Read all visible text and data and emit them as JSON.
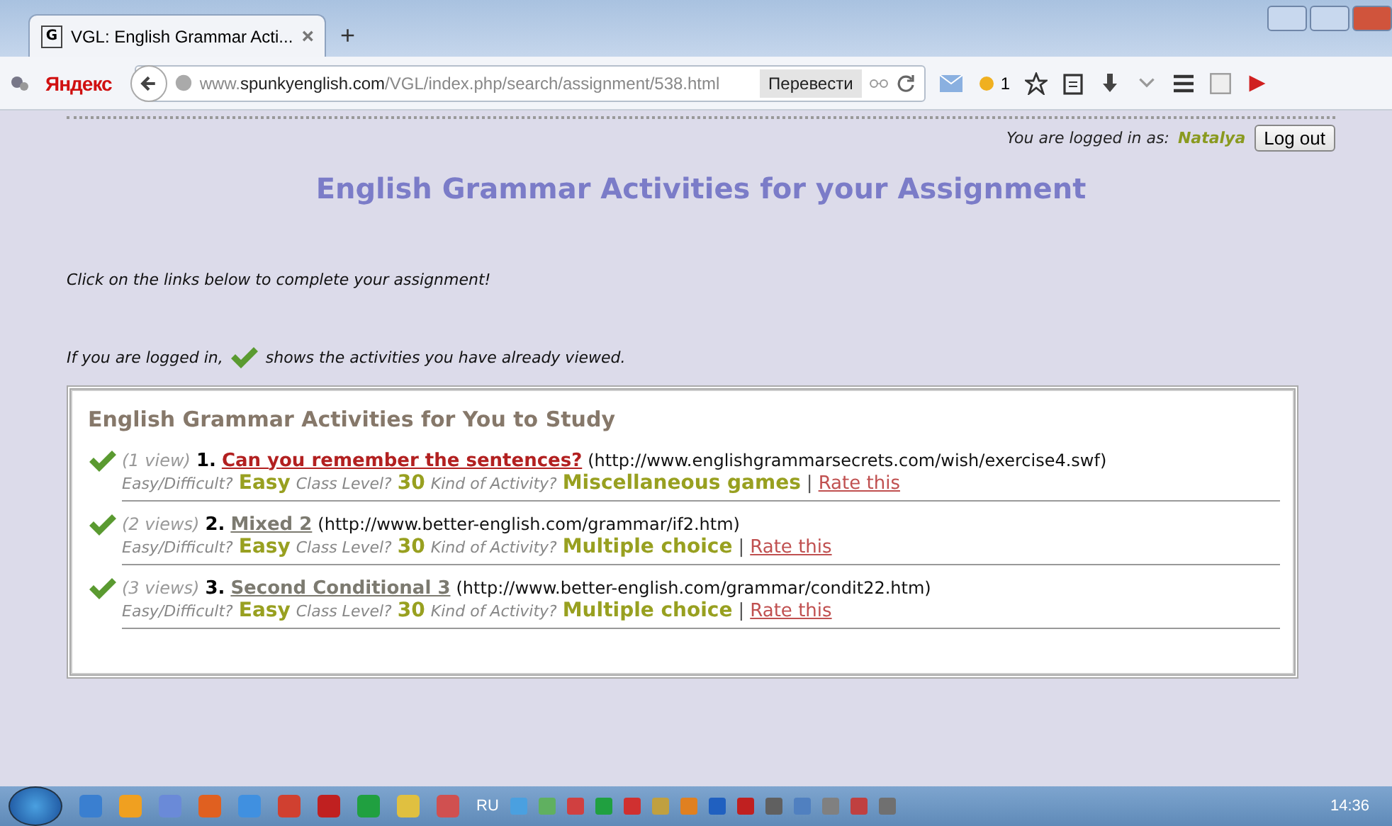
{
  "browser": {
    "favicon": "G",
    "tab_title": "VGL: English Grammar Acti...",
    "new_tab": "+",
    "brand": "Яндекс",
    "url": "www.**spunkyenglish.com**/VGL/index.php/search/assignment/538.html",
    "translate_button": "Перевести",
    "weather_count": "1"
  },
  "login": {
    "label": "You are logged in as:",
    "user": "Natalya",
    "logout_button": "Log out"
  },
  "page_title": "English Grammar Activities for your Assignment",
  "intro": "Click on the links below to complete your assignment!",
  "legend": {
    "before": "If you are logged in,",
    "after": "shows the activities you have already viewed."
  },
  "panel": {
    "title": "English Grammar Activities for You to Study",
    "activities": [
      {
        "viewed": true,
        "views": "(1 view)",
        "number": "1.",
        "title": "Can you remember the sentences?",
        "visited": false,
        "url": "(http://www.englishgrammarsecrets.com/wish/exercise4.swf)",
        "difficulty_label": "Easy/Difficult?",
        "difficulty": "Easy",
        "level_label": "Class Level?",
        "class_level": "30",
        "kind_label": "Kind of Activity?",
        "kind": "Miscellaneous games",
        "separator": "|",
        "rate": "Rate this"
      },
      {
        "viewed": true,
        "views": "(2 views)",
        "number": "2.",
        "title": "Mixed 2",
        "visited": true,
        "url": "(http://www.better-english.com/grammar/if2.htm)",
        "difficulty_label": "Easy/Difficult?",
        "difficulty": "Easy",
        "level_label": "Class Level?",
        "class_level": "30",
        "kind_label": "Kind of Activity?",
        "kind": "Multiple choice",
        "separator": "|",
        "rate": "Rate this"
      },
      {
        "viewed": true,
        "views": "(3 views)",
        "number": "3.",
        "title": "Second Conditional 3",
        "visited": true,
        "url": "(http://www.better-english.com/grammar/condit22.htm)",
        "difficulty_label": "Easy/Difficult?",
        "difficulty": "Easy",
        "level_label": "Class Level?",
        "class_level": "30",
        "kind_label": "Kind of Activity?",
        "kind": "Multiple choice",
        "separator": "|",
        "rate": "Rate this"
      }
    ]
  },
  "taskbar": {
    "language": "RU",
    "clock": "14:36"
  }
}
